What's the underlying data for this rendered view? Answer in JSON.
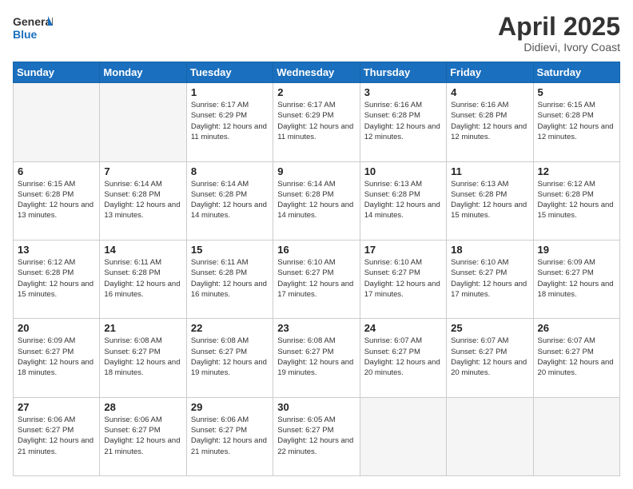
{
  "logo": {
    "line1": "General",
    "line2": "Blue"
  },
  "title": "April 2025",
  "location": "Didievi, Ivory Coast",
  "days_of_week": [
    "Sunday",
    "Monday",
    "Tuesday",
    "Wednesday",
    "Thursday",
    "Friday",
    "Saturday"
  ],
  "weeks": [
    [
      {
        "day": "",
        "info": ""
      },
      {
        "day": "",
        "info": ""
      },
      {
        "day": "1",
        "info": "Sunrise: 6:17 AM\nSunset: 6:29 PM\nDaylight: 12 hours and 11 minutes."
      },
      {
        "day": "2",
        "info": "Sunrise: 6:17 AM\nSunset: 6:29 PM\nDaylight: 12 hours and 11 minutes."
      },
      {
        "day": "3",
        "info": "Sunrise: 6:16 AM\nSunset: 6:28 PM\nDaylight: 12 hours and 12 minutes."
      },
      {
        "day": "4",
        "info": "Sunrise: 6:16 AM\nSunset: 6:28 PM\nDaylight: 12 hours and 12 minutes."
      },
      {
        "day": "5",
        "info": "Sunrise: 6:15 AM\nSunset: 6:28 PM\nDaylight: 12 hours and 12 minutes."
      }
    ],
    [
      {
        "day": "6",
        "info": "Sunrise: 6:15 AM\nSunset: 6:28 PM\nDaylight: 12 hours and 13 minutes."
      },
      {
        "day": "7",
        "info": "Sunrise: 6:14 AM\nSunset: 6:28 PM\nDaylight: 12 hours and 13 minutes."
      },
      {
        "day": "8",
        "info": "Sunrise: 6:14 AM\nSunset: 6:28 PM\nDaylight: 12 hours and 14 minutes."
      },
      {
        "day": "9",
        "info": "Sunrise: 6:14 AM\nSunset: 6:28 PM\nDaylight: 12 hours and 14 minutes."
      },
      {
        "day": "10",
        "info": "Sunrise: 6:13 AM\nSunset: 6:28 PM\nDaylight: 12 hours and 14 minutes."
      },
      {
        "day": "11",
        "info": "Sunrise: 6:13 AM\nSunset: 6:28 PM\nDaylight: 12 hours and 15 minutes."
      },
      {
        "day": "12",
        "info": "Sunrise: 6:12 AM\nSunset: 6:28 PM\nDaylight: 12 hours and 15 minutes."
      }
    ],
    [
      {
        "day": "13",
        "info": "Sunrise: 6:12 AM\nSunset: 6:28 PM\nDaylight: 12 hours and 15 minutes."
      },
      {
        "day": "14",
        "info": "Sunrise: 6:11 AM\nSunset: 6:28 PM\nDaylight: 12 hours and 16 minutes."
      },
      {
        "day": "15",
        "info": "Sunrise: 6:11 AM\nSunset: 6:28 PM\nDaylight: 12 hours and 16 minutes."
      },
      {
        "day": "16",
        "info": "Sunrise: 6:10 AM\nSunset: 6:27 PM\nDaylight: 12 hours and 17 minutes."
      },
      {
        "day": "17",
        "info": "Sunrise: 6:10 AM\nSunset: 6:27 PM\nDaylight: 12 hours and 17 minutes."
      },
      {
        "day": "18",
        "info": "Sunrise: 6:10 AM\nSunset: 6:27 PM\nDaylight: 12 hours and 17 minutes."
      },
      {
        "day": "19",
        "info": "Sunrise: 6:09 AM\nSunset: 6:27 PM\nDaylight: 12 hours and 18 minutes."
      }
    ],
    [
      {
        "day": "20",
        "info": "Sunrise: 6:09 AM\nSunset: 6:27 PM\nDaylight: 12 hours and 18 minutes."
      },
      {
        "day": "21",
        "info": "Sunrise: 6:08 AM\nSunset: 6:27 PM\nDaylight: 12 hours and 18 minutes."
      },
      {
        "day": "22",
        "info": "Sunrise: 6:08 AM\nSunset: 6:27 PM\nDaylight: 12 hours and 19 minutes."
      },
      {
        "day": "23",
        "info": "Sunrise: 6:08 AM\nSunset: 6:27 PM\nDaylight: 12 hours and 19 minutes."
      },
      {
        "day": "24",
        "info": "Sunrise: 6:07 AM\nSunset: 6:27 PM\nDaylight: 12 hours and 20 minutes."
      },
      {
        "day": "25",
        "info": "Sunrise: 6:07 AM\nSunset: 6:27 PM\nDaylight: 12 hours and 20 minutes."
      },
      {
        "day": "26",
        "info": "Sunrise: 6:07 AM\nSunset: 6:27 PM\nDaylight: 12 hours and 20 minutes."
      }
    ],
    [
      {
        "day": "27",
        "info": "Sunrise: 6:06 AM\nSunset: 6:27 PM\nDaylight: 12 hours and 21 minutes."
      },
      {
        "day": "28",
        "info": "Sunrise: 6:06 AM\nSunset: 6:27 PM\nDaylight: 12 hours and 21 minutes."
      },
      {
        "day": "29",
        "info": "Sunrise: 6:06 AM\nSunset: 6:27 PM\nDaylight: 12 hours and 21 minutes."
      },
      {
        "day": "30",
        "info": "Sunrise: 6:05 AM\nSunset: 6:27 PM\nDaylight: 12 hours and 22 minutes."
      },
      {
        "day": "",
        "info": ""
      },
      {
        "day": "",
        "info": ""
      },
      {
        "day": "",
        "info": ""
      }
    ]
  ]
}
